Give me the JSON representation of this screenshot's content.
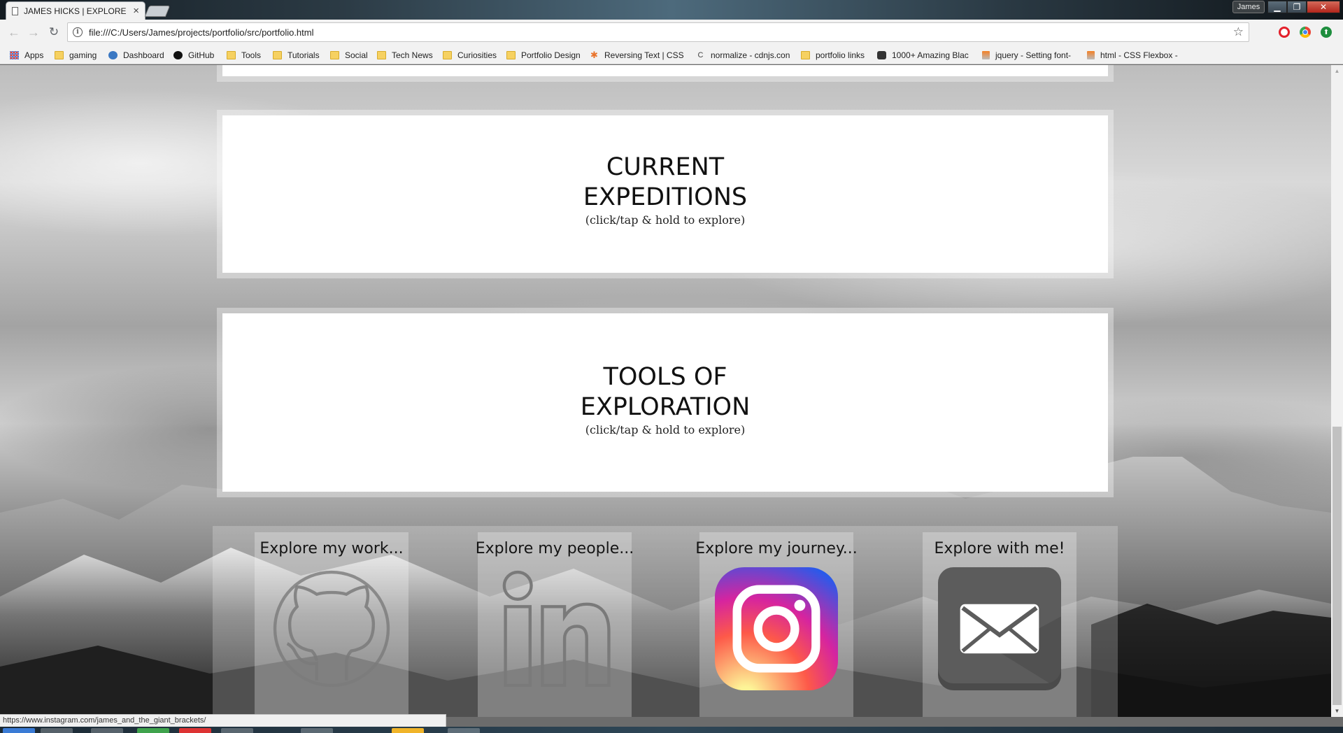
{
  "browser": {
    "tab_title": "JAMES HICKS | EXPLORE",
    "tab_close": "×",
    "profile_name": "James",
    "url": "file:///C:/Users/James/projects/portfolio/src/portfolio.html",
    "status_url": "https://www.instagram.com/james_and_the_giant_brackets/",
    "bookmarks": [
      {
        "label": "Apps",
        "icon": "apps-icon"
      },
      {
        "label": "gaming",
        "icon": "folder-icon"
      },
      {
        "label": "Dashboard",
        "icon": "dashboard-icon"
      },
      {
        "label": "GitHub",
        "icon": "github-icon"
      },
      {
        "label": "Tools",
        "icon": "folder-icon"
      },
      {
        "label": "Tutorials",
        "icon": "folder-icon"
      },
      {
        "label": "Social",
        "icon": "folder-icon"
      },
      {
        "label": "Tech News",
        "icon": "folder-icon"
      },
      {
        "label": "Curiosities",
        "icon": "folder-icon"
      },
      {
        "label": "Portfolio Design",
        "icon": "folder-icon"
      },
      {
        "label": "Reversing Text | CSS-",
        "icon": "css-tricks-icon"
      },
      {
        "label": "normalize - cdnjs.con",
        "icon": "cdnjs-icon"
      },
      {
        "label": "portfolio links",
        "icon": "folder-icon"
      },
      {
        "label": "1000+ Amazing Blac",
        "icon": "instagram-icon"
      },
      {
        "label": "jquery - Setting font-",
        "icon": "stackoverflow-icon"
      },
      {
        "label": "html - CSS Flexbox -",
        "icon": "stackoverflow-icon"
      }
    ]
  },
  "page": {
    "sections": [
      {
        "heading_line1": "CURRENT",
        "heading_line2": "EXPEDITIONS",
        "subtitle": "(click/tap & hold to explore)"
      },
      {
        "heading_line1": "TOOLS OF",
        "heading_line2": "EXPLORATION",
        "subtitle": "(click/tap & hold to explore)"
      }
    ],
    "contacts": [
      {
        "label": "Explore my work...",
        "icon": "github-icon"
      },
      {
        "label": "Explore my people...",
        "icon": "linkedin-icon"
      },
      {
        "label": "Explore my journey...",
        "icon": "instagram-icon"
      },
      {
        "label": "Explore with me!",
        "icon": "mail-icon"
      }
    ]
  }
}
